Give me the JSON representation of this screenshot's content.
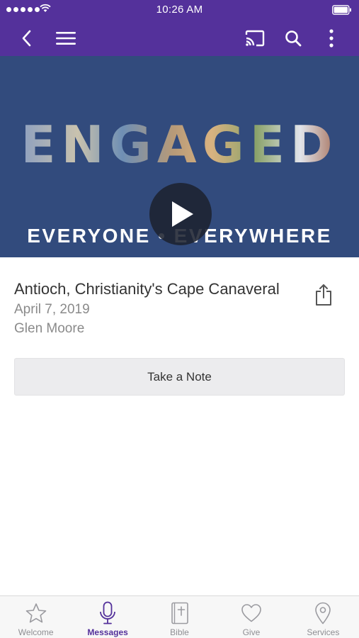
{
  "status_bar": {
    "time": "10:26 AM"
  },
  "app_bar": {
    "icons": [
      "back-icon",
      "menu-icon",
      "cast-icon",
      "search-icon",
      "more-icon"
    ]
  },
  "hero": {
    "title": "ENGAGED",
    "subtitle": "EVERYONE • EVERYWHERE"
  },
  "message": {
    "title": "Antioch, Christianity's Cape Canaveral",
    "date": "April 7, 2019",
    "speaker": "Glen Moore"
  },
  "actions": {
    "take_note_label": "Take a Note"
  },
  "tab_bar": {
    "tabs": [
      {
        "label": "Welcome",
        "icon": "star-icon"
      },
      {
        "label": "Messages",
        "icon": "microphone-icon"
      },
      {
        "label": "Bible",
        "icon": "bible-icon"
      },
      {
        "label": "Give",
        "icon": "heart-icon"
      },
      {
        "label": "Services",
        "icon": "location-pin-icon"
      }
    ],
    "active": "Messages"
  },
  "colors": {
    "brand": "#54319b",
    "hero_background": "#324b7d",
    "button_background": "#ececee",
    "inactive_tab": "#8e8e93"
  }
}
